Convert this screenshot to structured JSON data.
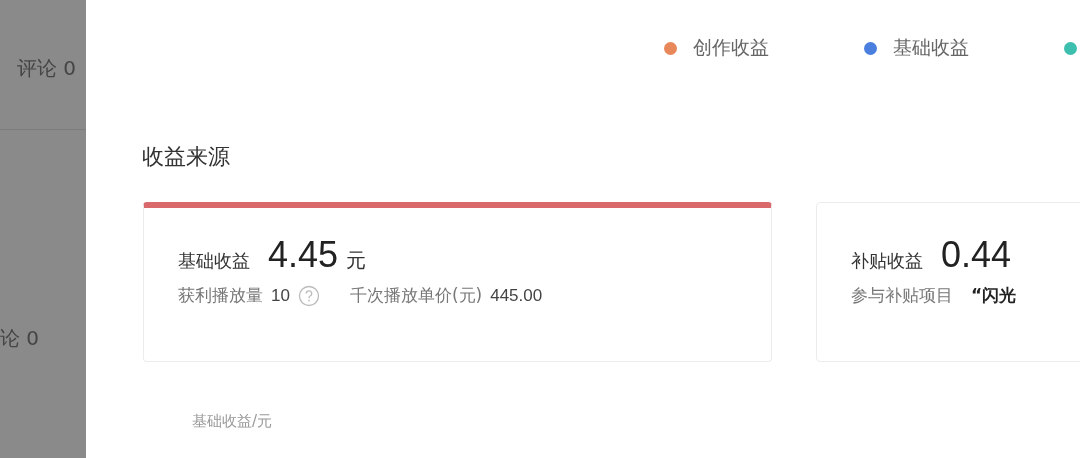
{
  "side_panel": {
    "items": [
      "评论 0",
      "论 0"
    ]
  },
  "legend": [
    {
      "label": "创作收益",
      "color": "#e8875a"
    },
    {
      "label": "基础收益",
      "color": "#4a7fe0"
    },
    {
      "color": "#3cbfae"
    }
  ],
  "section_title": "收益来源",
  "cards": [
    {
      "label": "基础收益",
      "amount": "4.45",
      "unit": "元",
      "selected": true,
      "stats": [
        {
          "kind": "plain",
          "label": "获利播放量",
          "value": "10",
          "help": true
        },
        {
          "kind": "plain",
          "label": "千次播放单价(元)",
          "value": "445.00",
          "help": false
        }
      ]
    },
    {
      "label": "补贴收益",
      "amount": "0.44",
      "selected": false,
      "stats": [
        {
          "kind": "quote",
          "label": "参与补贴项目",
          "value": "“闪光",
          "help": false
        }
      ]
    }
  ],
  "chart_axis_label": "基础收益/元"
}
